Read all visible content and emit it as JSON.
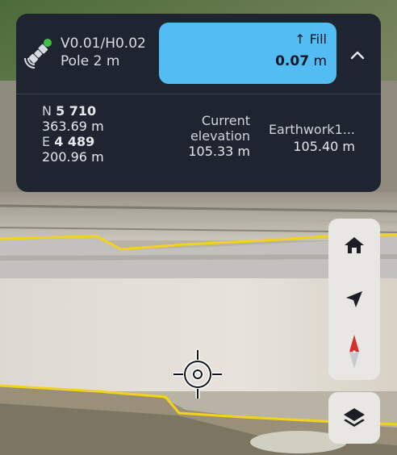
{
  "status": {
    "tolerance": "V0.01/H0.02",
    "pole": "Pole 2 m"
  },
  "cut_fill": {
    "label": "↑ Fill",
    "value": "0.07",
    "unit": "m"
  },
  "position": {
    "n_label": "N",
    "n_value_a": "5 710",
    "n_value_b": "363.69 m",
    "e_label": "E",
    "e_value_a": "4 489",
    "e_value_b": "200.96 m"
  },
  "current_elevation": {
    "label_line1": "Current",
    "label_line2": "elevation",
    "value": "105.33 m"
  },
  "earthwork": {
    "name": "Earthwork1...",
    "value": "105.40 m"
  },
  "icons": {
    "gnss": "satellite-icon",
    "collapse": "chevron-up-icon",
    "home": "home-icon",
    "locate": "navigation-arrow-icon",
    "compass": "compass-icon",
    "layers": "layers-icon",
    "crosshair": "crosshair-icon"
  },
  "colors": {
    "panel_bg": "#1f2530",
    "fill_accent": "#53bdf3",
    "gnss_fix": "#3fbf4a",
    "boundary_line": "#f2d21b",
    "compass_north": "#d3302b"
  }
}
